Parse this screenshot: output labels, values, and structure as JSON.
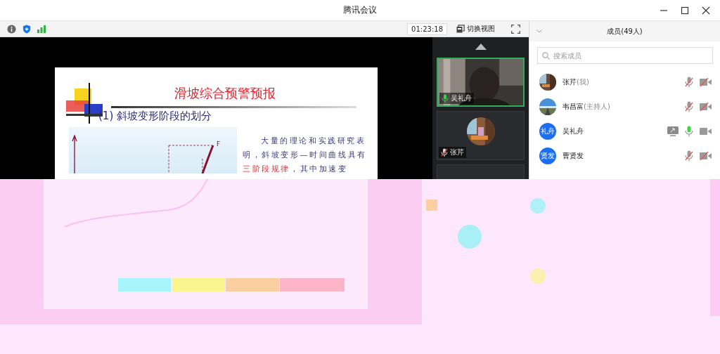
{
  "window": {
    "title": "腾讯会议"
  },
  "toolbar": {
    "timer": "01:23:18",
    "switch_view": "切换视图"
  },
  "slide": {
    "title": "滑坡综合预警预报",
    "subtitle": "(1)  斜坡变形阶段的划分",
    "diagram_labels": {
      "point": "F"
    },
    "body": [
      {
        "text": "大量的理论和实践研究表"
      },
      {
        "text": "明，斜坡变形—时间曲线具有"
      },
      {
        "highlight": "三阶段规律",
        "text": "，其中加速变"
      }
    ]
  },
  "video_tiles": [
    {
      "name": "吴礼舟",
      "speaking": true,
      "kind": "camera"
    },
    {
      "name": "张芹",
      "speaking": false,
      "kind": "avatar"
    }
  ],
  "members_panel": {
    "title": "成员(49人)",
    "search": {
      "placeholder": "搜索成员"
    },
    "members": [
      {
        "name": "张芹",
        "note": "(我)",
        "sharing": false,
        "muted": true,
        "camera_on": false
      },
      {
        "name": "韦昌富",
        "note": "(主持人)",
        "sharing": false,
        "muted": true,
        "camera_on": false
      },
      {
        "name": "吴礼舟",
        "avatar": {
          "kind": "initials",
          "text": "礼舟"
        },
        "sharing": true,
        "muted": false,
        "camera_on": true
      },
      {
        "name": "曹贤发",
        "avatar": {
          "kind": "initials",
          "text": "贤发"
        },
        "sharing": false,
        "muted": true,
        "camera_on": false
      }
    ]
  }
}
